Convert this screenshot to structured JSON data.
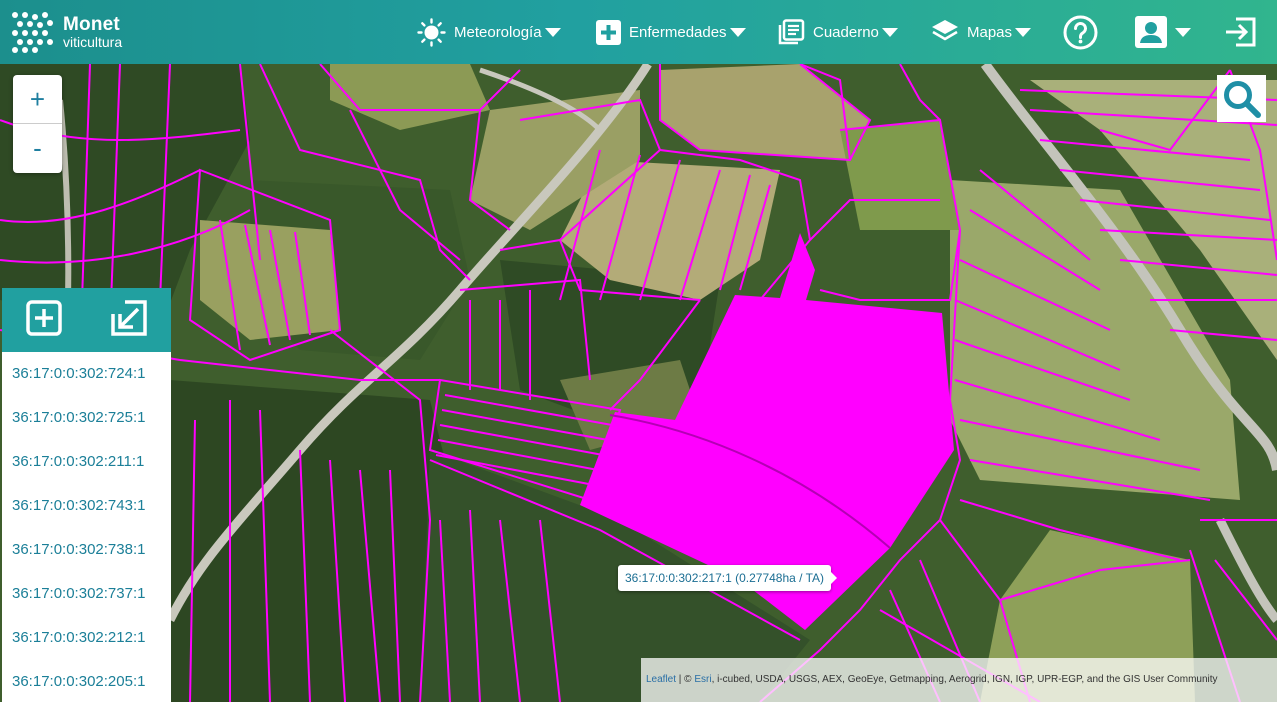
{
  "brand": {
    "name": "Monet",
    "sub": "viticultura"
  },
  "nav": {
    "meteo": "Meteorología",
    "enfermedades": "Enfermedades",
    "cuaderno": "Cuaderno",
    "mapas": "Mapas"
  },
  "map": {
    "zoom_in": "+",
    "zoom_out": "-",
    "tooltip": "36:17:0:0:302:217:1 (0.27748ha / TA)",
    "highlight_color": "#ff00ff",
    "attribution": {
      "leaflet": "Leaflet",
      "sep": " | © ",
      "esri": "Esri",
      "rest": ", i-cubed, USDA, USGS, AEX, GeoEye, Getmapping, Aerogrid, IGN, IGP, UPR-EGP, and the GIS User Community"
    }
  },
  "panel": {
    "parcels": [
      "36:17:0:0:302:724:1",
      "36:17:0:0:302:725:1",
      "36:17:0:0:302:211:1",
      "36:17:0:0:302:743:1",
      "36:17:0:0:302:738:1",
      "36:17:0:0:302:737:1",
      "36:17:0:0:302:212:1",
      "36:17:0:0:302:205:1"
    ]
  },
  "icons": {
    "sun": "sun-icon",
    "plus_box": "plus-box-icon",
    "notebook": "notebook-icon",
    "layers": "layers-icon",
    "help": "help-icon",
    "user": "user-icon",
    "logout": "logout-icon",
    "search": "search-icon",
    "add": "add-square-icon",
    "import": "import-arrow-icon"
  }
}
